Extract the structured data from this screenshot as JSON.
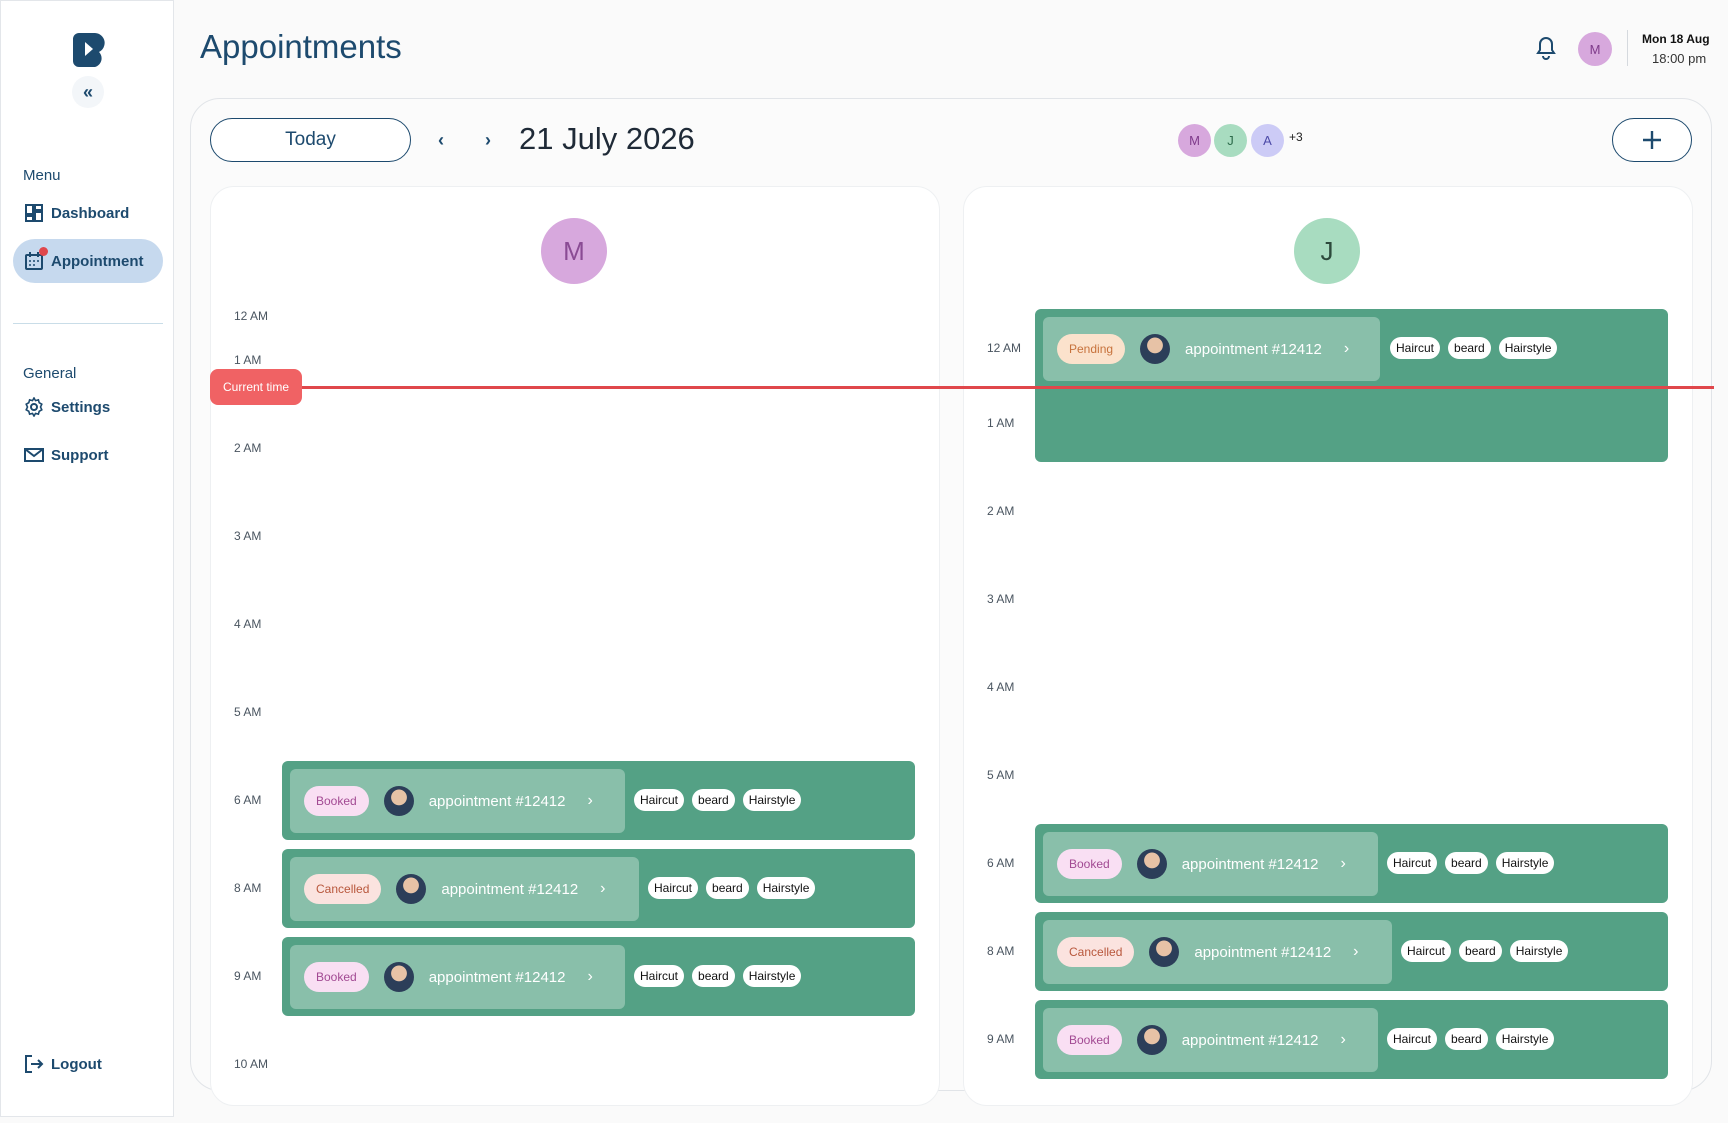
{
  "sidebar": {
    "menu_label": "Menu",
    "general_label": "General",
    "items": [
      {
        "label": "Dashboard"
      },
      {
        "label": "Appointment"
      },
      {
        "label": "Settings"
      },
      {
        "label": "Support"
      }
    ],
    "logout_label": "Logout",
    "collapse_glyph": "«"
  },
  "header": {
    "title": "Appointments",
    "user_initial": "M",
    "date": "Mon 18 Aug",
    "time": "18:00 pm"
  },
  "toolbar": {
    "today_label": "Today",
    "prev_glyph": "‹",
    "next_glyph": "›",
    "current_date": "21 July 2026",
    "staff": [
      "M",
      "J",
      "A"
    ],
    "more_staff": "+3",
    "add_glyph": "+"
  },
  "current_time_label": "Current time",
  "columns": [
    {
      "initial": "M",
      "hours": [
        "12 AM",
        "1 AM",
        "2 AM",
        "3 AM",
        "4 AM",
        "5 AM",
        "6 AM",
        "8 AM",
        "9 AM",
        "10 AM"
      ],
      "appointments": [
        {
          "status": "Booked",
          "title": "appointment #12412",
          "tags": [
            "Haircut",
            "beard",
            "Hairstyle"
          ]
        },
        {
          "status": "Cancelled",
          "title": "appointment #12412",
          "tags": [
            "Haircut",
            "beard",
            "Hairstyle"
          ]
        },
        {
          "status": "Booked",
          "title": "appointment #12412",
          "tags": [
            "Haircut",
            "beard",
            "Hairstyle"
          ]
        }
      ]
    },
    {
      "initial": "J",
      "hours": [
        "12 AM",
        "1 AM",
        "2 AM",
        "3 AM",
        "4 AM",
        "5 AM",
        "6 AM",
        "8 AM",
        "9 AM"
      ],
      "appointments": [
        {
          "status": "Pending",
          "title": "appointment #12412",
          "tags": [
            "Haircut",
            "beard",
            "Hairstyle"
          ]
        },
        {
          "status": "Booked",
          "title": "appointment #12412",
          "tags": [
            "Haircut",
            "beard",
            "Hairstyle"
          ]
        },
        {
          "status": "Cancelled",
          "title": "appointment #12412",
          "tags": [
            "Haircut",
            "beard",
            "Hairstyle"
          ]
        },
        {
          "status": "Booked",
          "title": "appointment #12412",
          "tags": [
            "Haircut",
            "beard",
            "Hairstyle"
          ]
        }
      ]
    }
  ],
  "colors": {
    "primary": "#1d4a6e",
    "appointment_block": "#54a185",
    "appointment_card": "#89bfaa",
    "current_time": "#e0474b",
    "active_nav": "#c6d9ee"
  }
}
